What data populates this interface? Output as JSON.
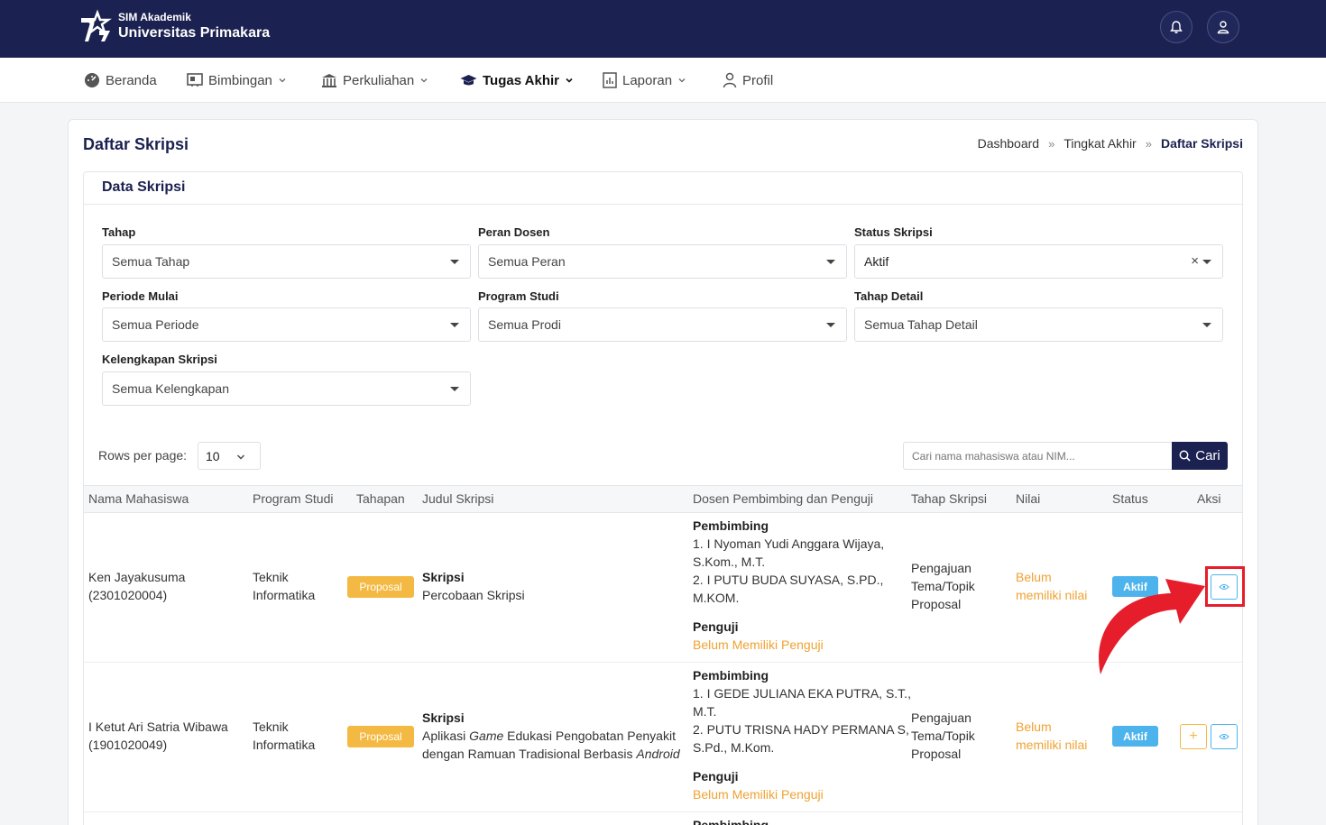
{
  "header": {
    "brand_sub": "SIM Akademik",
    "brand_main": "Universitas Primakara",
    "notification_icon": "bell-icon",
    "user_icon": "user-icon"
  },
  "nav": {
    "items": [
      {
        "label": "Beranda",
        "icon": "dashboard-icon",
        "dropdown": false
      },
      {
        "label": "Bimbingan",
        "icon": "presentation-icon",
        "dropdown": true
      },
      {
        "label": "Perkuliahan",
        "icon": "institution-icon",
        "dropdown": true
      },
      {
        "label": "Tugas Akhir",
        "icon": "graduation-cap-icon",
        "dropdown": true,
        "active": true
      },
      {
        "label": "Laporan",
        "icon": "report-icon",
        "dropdown": true
      },
      {
        "label": "Profil",
        "icon": "user-icon",
        "dropdown": false
      }
    ]
  },
  "page": {
    "title": "Daftar Skripsi",
    "breadcrumb": [
      "Dashboard",
      "Tingkat Akhir",
      "Daftar Skripsi"
    ],
    "breadcrumb_sep": "»",
    "section_title": "Data Skripsi"
  },
  "filters": {
    "tahap": {
      "label": "Tahap",
      "value": "Semua Tahap"
    },
    "peran_dosen": {
      "label": "Peran Dosen",
      "value": "Semua Peran"
    },
    "status_skripsi": {
      "label": "Status Skripsi",
      "value": "Aktif",
      "clear": "×"
    },
    "periode_mulai": {
      "label": "Periode Mulai",
      "value": "Semua Periode"
    },
    "program_studi": {
      "label": "Program Studi",
      "value": "Semua Prodi"
    },
    "tahap_detail": {
      "label": "Tahap Detail",
      "value": "Semua Tahap Detail"
    },
    "kelengkapan": {
      "label": "Kelengkapan Skripsi",
      "value": "Semua Kelengkapan"
    }
  },
  "table_controls": {
    "rows_label": "Rows per page:",
    "rows_value": "10",
    "search_placeholder": "Cari nama mahasiswa atau NIM...",
    "search_button": "Cari"
  },
  "table": {
    "headers": [
      "Nama Mahasiswa",
      "Program Studi",
      "Tahapan",
      "Judul Skripsi",
      "Dosen Pembimbing dan Penguji",
      "Tahap Skripsi",
      "Nilai",
      "Status",
      "Aksi"
    ],
    "rows": [
      {
        "name": "Ken Jayakusuma",
        "nim": "(2301020004)",
        "prodi_1": "Teknik",
        "prodi_2": "Informatika",
        "tahapan": "Proposal",
        "judul_type": "Skripsi",
        "judul": "Percobaan Skripsi",
        "pembimbing_label": "Pembimbing",
        "pembimbing_1a": "1. I Nyoman Yudi Anggara Wijaya,",
        "pembimbing_1b": "S.Kom., M.T.",
        "pembimbing_2a": "2. I PUTU BUDA SUYASA, S.PD.,",
        "pembimbing_2b": "M.KOM.",
        "penguji_label": "Penguji",
        "penguji": "Belum Memiliki Penguji",
        "tahap_1": "Pengajuan",
        "tahap_2": "Tema/Topik",
        "tahap_3": "Proposal",
        "nilai_1": "Belum",
        "nilai_2": "memiliki nilai",
        "status": "Aktif"
      },
      {
        "name": "I Ketut Ari Satria Wibawa",
        "nim": "(1901020049)",
        "prodi_1": "Teknik",
        "prodi_2": "Informatika",
        "tahapan": "Proposal",
        "judul_type": "Skripsi",
        "judul_1a": "Aplikasi ",
        "judul_1b": "Game",
        "judul_1c": " Edukasi Pengobatan Penyakit",
        "judul_2a": "dengan Ramuan Tradisional Berbasis ",
        "judul_2b": "Android",
        "pembimbing_label": "Pembimbing",
        "pembimbing_1a": "1. I GEDE JULIANA EKA PUTRA, S.T.,",
        "pembimbing_1b": "M.T.",
        "pembimbing_2a": "2. PUTU TRISNA HADY PERMANA S,",
        "pembimbing_2b": "S.Pd., M.Kom.",
        "penguji_label": "Penguji",
        "penguji": "Belum Memiliki Penguji",
        "tahap_1": "Pengajuan",
        "tahap_2": "Tema/Topik",
        "tahap_3": "Proposal",
        "nilai_1": "Belum",
        "nilai_2": "memiliki nilai",
        "status": "Aktif",
        "add_symbol": "+"
      },
      {
        "pembimbing_label": "Pembimbing"
      }
    ]
  },
  "colors": {
    "primary": "#1b2150",
    "accent_orange": "#f0a232",
    "badge_orange": "#f4b942",
    "badge_blue": "#4db3ec",
    "highlight_red": "#e61d2b"
  }
}
